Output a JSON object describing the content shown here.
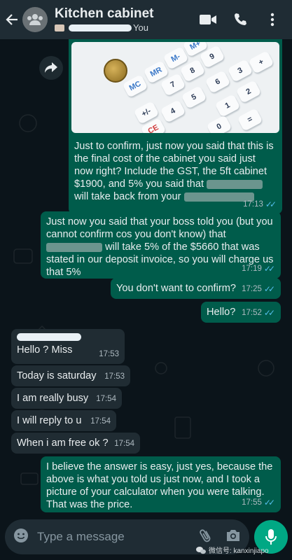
{
  "header": {
    "title": "Kitchen cabinet",
    "members_suffix": "You"
  },
  "messages": {
    "m1": {
      "text": "Just to confirm, just now you said that this is the final cost of the cabinet you said just now right? Include the GST, the 5ft cabinet $1900, and 5% you said that",
      "text_after": "will take back from your",
      "time": "17:13"
    },
    "m2": {
      "text": "Just now you said that your boss told you (but you cannot confirm cos you don't know) that",
      "text_after": "will take 5% of the $5660 that was stated in our deposit invoice, so you will charge us that 5%",
      "time": "17:19"
    },
    "m3": {
      "text": "You don't want to confirm?",
      "time": "17:25"
    },
    "m4": {
      "text": "Hello?",
      "time": "17:52"
    },
    "m5": {
      "text": "Hello ? Miss",
      "time": "17:53"
    },
    "m6": {
      "text": "Today is saturday",
      "time": "17:53"
    },
    "m7": {
      "text": "I am really busy",
      "time": "17:54"
    },
    "m8": {
      "text": "I will reply to u",
      "time": "17:54"
    },
    "m9": {
      "text": "When i am free ok ?",
      "time": "17:54"
    },
    "m10": {
      "text": "I believe the answer is easy, just yes, because the above is what you told us just now, and I took a picture of your calculator when you were talking. That was the price.",
      "time": "17:55"
    }
  },
  "calculator": {
    "keys": [
      "MC",
      "MR",
      "M-",
      "M+",
      "7",
      "8",
      "9",
      "6",
      "5",
      "4",
      "+/-",
      "CE",
      "1",
      "2",
      "3",
      "0",
      "+",
      "="
    ]
  },
  "composer": {
    "placeholder": "Type a message"
  },
  "watermark": {
    "label": "微信号: kanxinjiapo"
  },
  "colors": {
    "outgoing_bubble": "#005c4b",
    "incoming_bubble": "#202c33",
    "read_ticks": "#53bdeb",
    "accent": "#00a884"
  },
  "icons": [
    "back-arrow-icon",
    "group-avatar-icon",
    "video-call-icon",
    "phone-icon",
    "more-vertical-icon",
    "forward-icon",
    "emoji-icon",
    "attach-icon",
    "camera-icon",
    "mic-icon",
    "double-tick-icon"
  ]
}
